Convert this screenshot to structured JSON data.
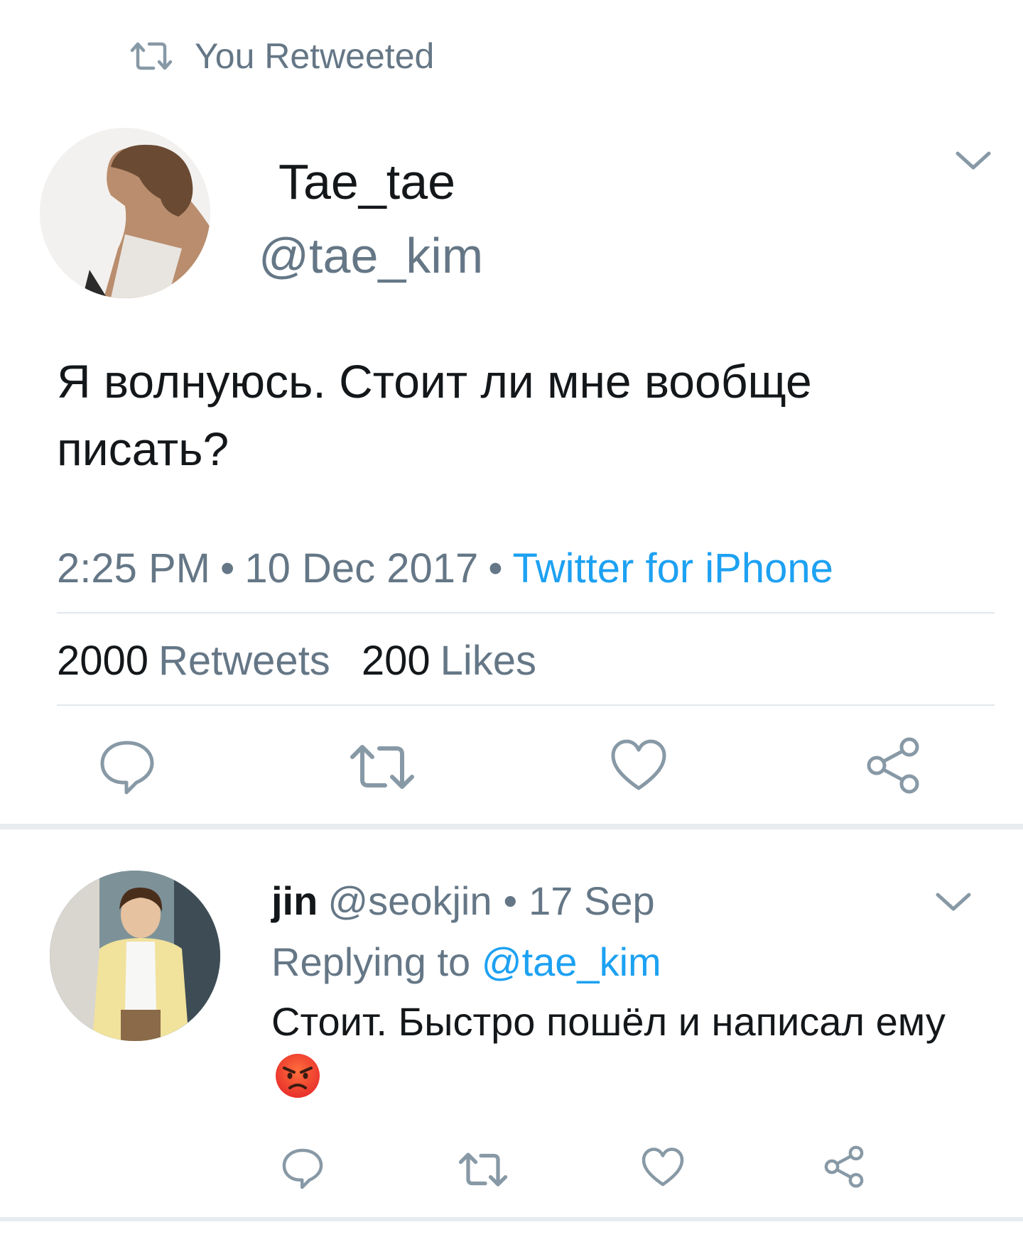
{
  "retweet_header": {
    "label": "You Retweeted",
    "icon": "retweet-icon"
  },
  "main_tweet": {
    "display_name": "Tae_tae",
    "handle": "@tae_kim",
    "text": "Я волнуюсь. Стоит ли мне вообще писать?",
    "time": "2:25 PM",
    "date": "10 Dec 2017",
    "source": "Twitter for iPhone",
    "separator": "•",
    "retweets_count": "2000",
    "retweets_label": "Retweets",
    "likes_count": "200",
    "likes_label": "Likes",
    "actions": [
      "reply-icon",
      "retweet-icon",
      "like-icon",
      "share-icon"
    ]
  },
  "reply_tweet": {
    "display_name": "jin",
    "handle": "@seokjin",
    "separator": "•",
    "date": "17 Sep",
    "replying_prefix": "Replying to",
    "replying_handle": "@tae_kim",
    "text": "Стоит. Быстро пошёл и написал ему",
    "emoji": "angry-face-emoji",
    "actions": [
      "reply-icon",
      "retweet-icon",
      "like-icon",
      "share-icon"
    ]
  },
  "colors": {
    "text_primary": "#14171a",
    "text_secondary": "#657786",
    "link": "#1da1f2",
    "icon": "#8899a6",
    "divider": "#e1e8ed"
  }
}
